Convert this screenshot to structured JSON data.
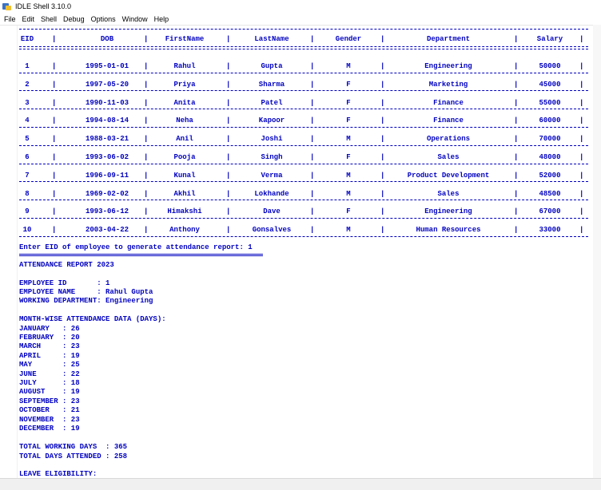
{
  "window": {
    "title": "IDLE Shell 3.10.0",
    "icon": "python-idle-icon"
  },
  "menu": [
    "File",
    "Edit",
    "Shell",
    "Debug",
    "Options",
    "Window",
    "Help"
  ],
  "table": {
    "headers": [
      "EID",
      "DOB",
      "FirstName",
      "LastName",
      "Gender",
      "Department",
      "Salary"
    ],
    "rows": [
      [
        "1",
        "1995-01-01",
        "Rahul",
        "Gupta",
        "M",
        "Engineering",
        "50000"
      ],
      [
        "2",
        "1997-05-20",
        "Priya",
        "Sharma",
        "F",
        "Marketing",
        "45000"
      ],
      [
        "3",
        "1990-11-03",
        "Anita",
        "Patel",
        "F",
        "Finance",
        "55000"
      ],
      [
        "4",
        "1994-08-14",
        "Neha",
        "Kapoor",
        "F",
        "Finance",
        "60000"
      ],
      [
        "5",
        "1988-03-21",
        "Anil",
        "Joshi",
        "M",
        "Operations",
        "70000"
      ],
      [
        "6",
        "1993-06-02",
        "Pooja",
        "Singh",
        "F",
        "Sales",
        "48000"
      ],
      [
        "7",
        "1996-09-11",
        "Kunal",
        "Verma",
        "M",
        "Product Development",
        "52000"
      ],
      [
        "8",
        "1969-02-02",
        "Akhil",
        "Lokhande",
        "M",
        "Sales",
        "48500"
      ],
      [
        "9",
        "1993-06-12",
        "Himakshi",
        "Dave",
        "F",
        "Engineering",
        "67000"
      ],
      [
        "10",
        "2003-04-22",
        "Anthony",
        "Gonsalves",
        "M",
        "Human Resources",
        "33000"
      ]
    ]
  },
  "prompt": "Enter EID of employee to generate attendance report: 1",
  "report": {
    "title": "ATTENDANCE REPORT 2023",
    "employee_id": "EMPLOYEE ID       : 1",
    "employee_name": "EMPLOYEE NAME     : Rahul Gupta",
    "department": "WORKING DEPARTMENT: Engineering",
    "monthwise_heading": "MONTH-WISE ATTENDANCE DATA (DAYS):",
    "months": [
      "JANUARY   : 26",
      "FEBRUARY  : 20",
      "MARCH     : 23",
      "APRIL     : 19",
      "MAY       : 25",
      "JUNE      : 22",
      "JULY      : 18",
      "AUGUST    : 19",
      "SEPTEMBER : 23",
      "OCTOBER   : 21",
      "NOVEMBER  : 23",
      "DECEMBER  : 19"
    ],
    "total_working": "TOTAL WORKING DAYS  : 365",
    "total_attended": "TOTAL DAYS ATTENDED : 258",
    "leave_heading": "LEAVE ELIGIBILITY:"
  },
  "colors": {
    "output": "#0000c0",
    "background": "#ffffff"
  }
}
